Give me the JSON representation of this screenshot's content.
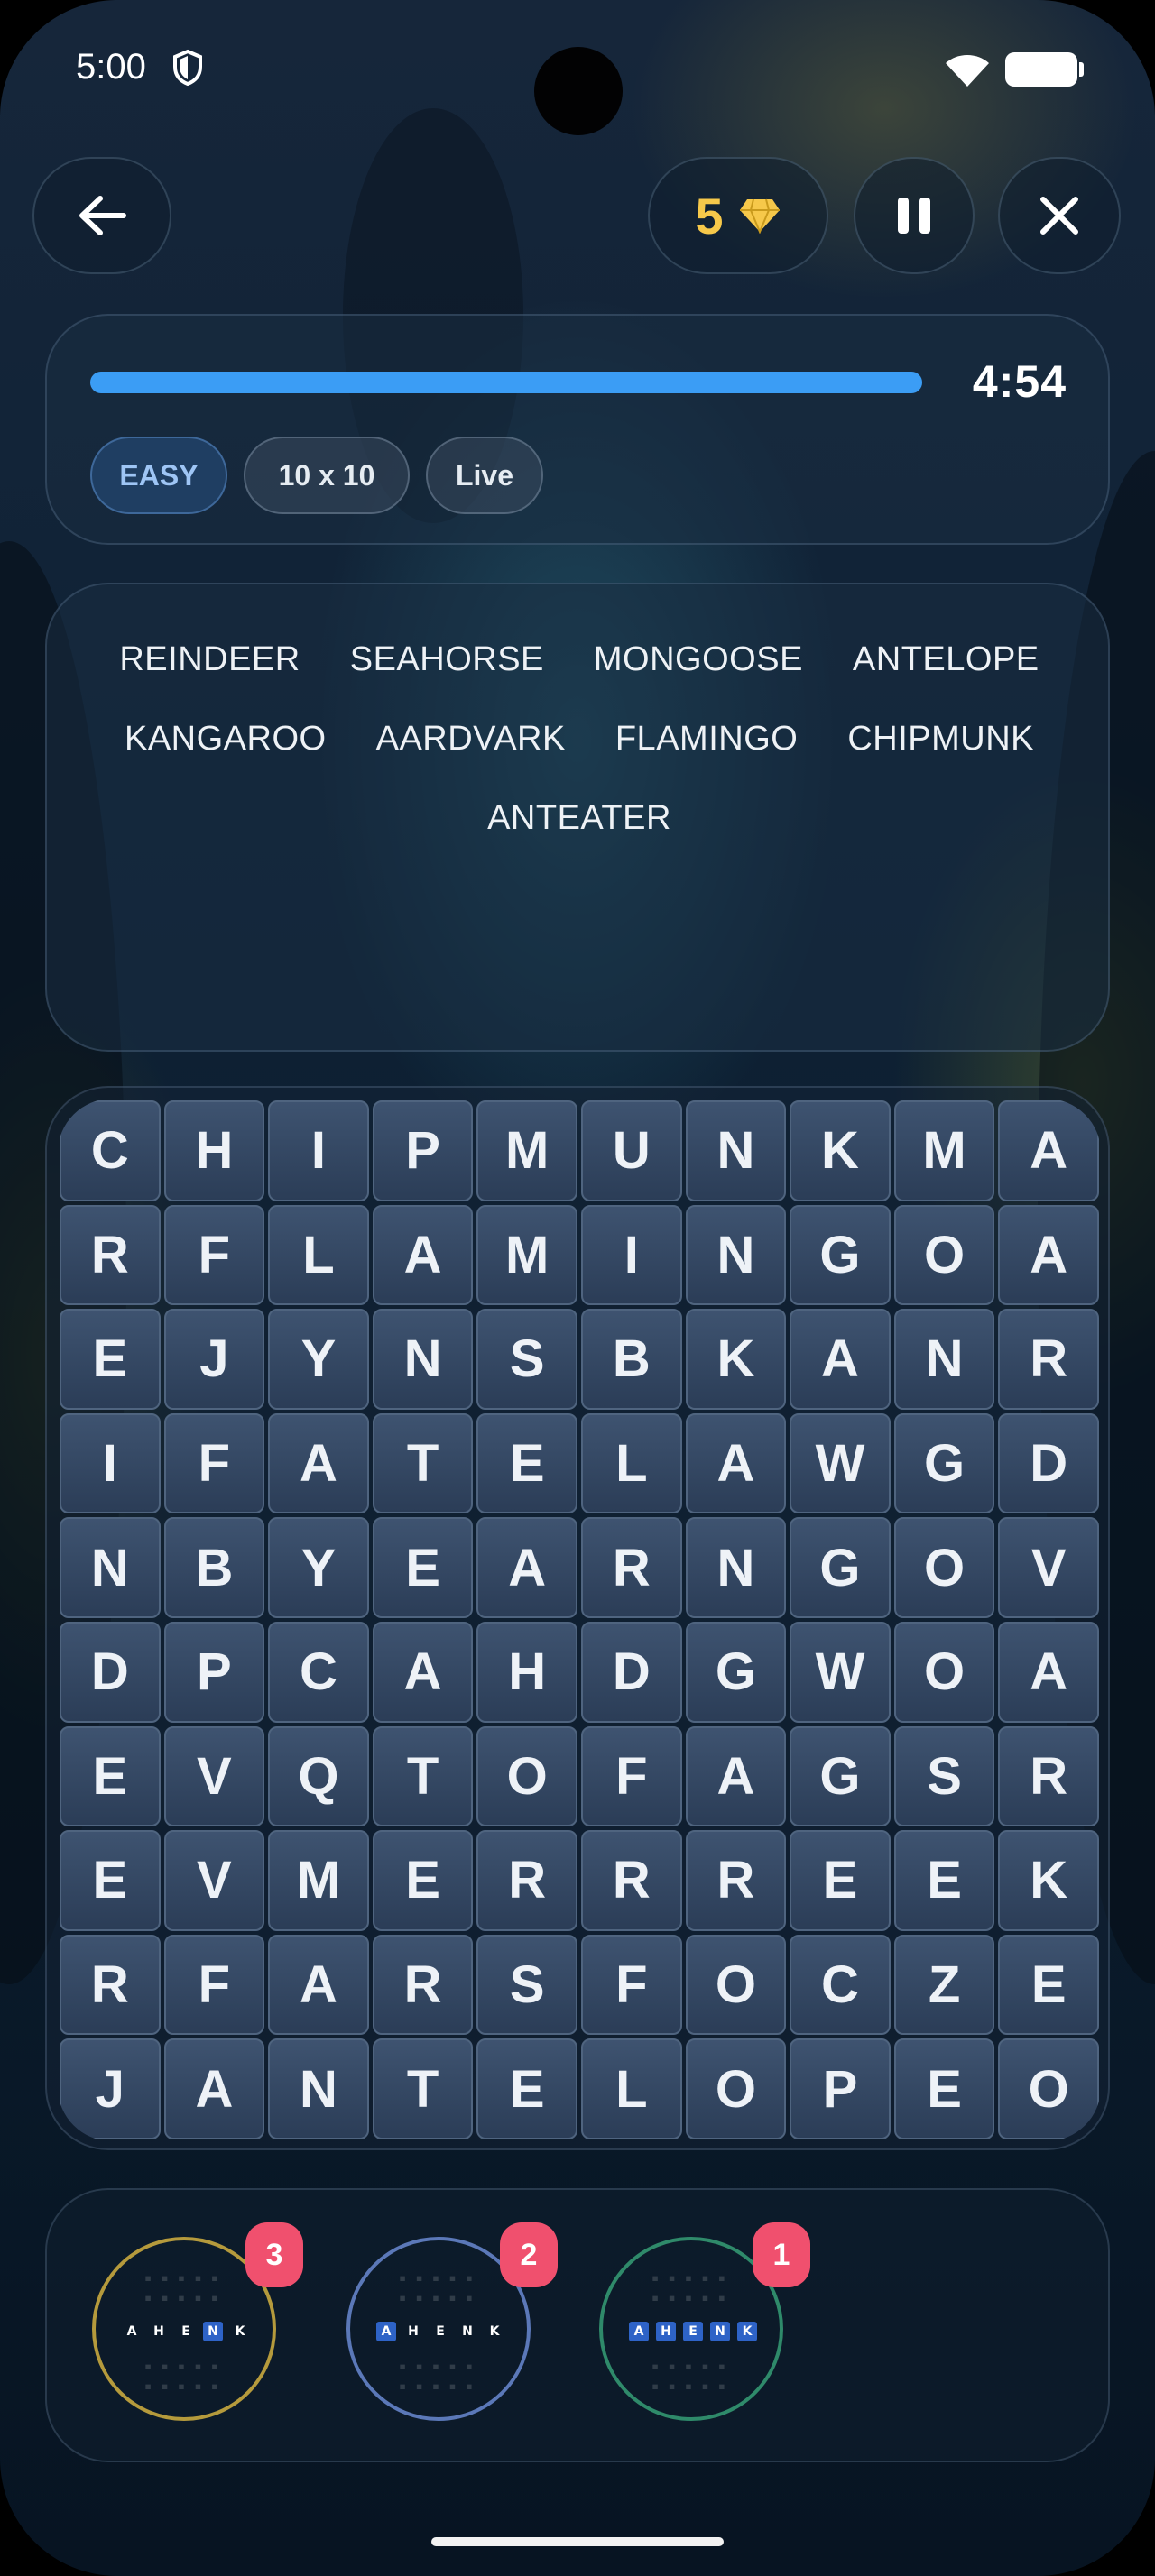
{
  "status_bar": {
    "time": "5:00"
  },
  "toolbar": {
    "gems": "5"
  },
  "game_info": {
    "timer": "4:54",
    "progress": 1.0,
    "difficulty": "EASY",
    "grid_size": "10 x 10",
    "mode": "Live"
  },
  "words": [
    "REINDEER",
    "SEAHORSE",
    "MONGOOSE",
    "ANTELOPE",
    "KANGAROO",
    "AARDVARK",
    "FLAMINGO",
    "CHIPMUNK",
    "ANTEATER"
  ],
  "grid": [
    [
      "C",
      "H",
      "I",
      "P",
      "M",
      "U",
      "N",
      "K",
      "M",
      "A"
    ],
    [
      "R",
      "F",
      "L",
      "A",
      "M",
      "I",
      "N",
      "G",
      "O",
      "A"
    ],
    [
      "E",
      "J",
      "Y",
      "N",
      "S",
      "B",
      "K",
      "A",
      "N",
      "R"
    ],
    [
      "I",
      "F",
      "A",
      "T",
      "E",
      "L",
      "A",
      "W",
      "G",
      "D"
    ],
    [
      "N",
      "B",
      "Y",
      "E",
      "A",
      "R",
      "N",
      "G",
      "O",
      "V"
    ],
    [
      "D",
      "P",
      "C",
      "A",
      "H",
      "D",
      "G",
      "W",
      "O",
      "A"
    ],
    [
      "E",
      "V",
      "Q",
      "T",
      "O",
      "F",
      "A",
      "G",
      "S",
      "R"
    ],
    [
      "E",
      "V",
      "M",
      "E",
      "R",
      "R",
      "R",
      "E",
      "E",
      "K"
    ],
    [
      "R",
      "F",
      "A",
      "R",
      "S",
      "F",
      "O",
      "C",
      "Z",
      "E"
    ],
    [
      "J",
      "A",
      "N",
      "T",
      "E",
      "L",
      "O",
      "P",
      "E",
      "O"
    ]
  ],
  "hints": [
    {
      "count": "3",
      "color": "#b59a3c",
      "letters": [
        "A",
        "H",
        "E",
        "N",
        "K"
      ],
      "highlight": [
        3
      ]
    },
    {
      "count": "2",
      "color": "#5b78b8",
      "letters": [
        "A",
        "H",
        "E",
        "N",
        "K"
      ],
      "highlight": [
        0
      ]
    },
    {
      "count": "1",
      "color": "#2f8a6a",
      "letters": [
        "A",
        "H",
        "E",
        "N",
        "K"
      ],
      "highlight": [
        0,
        1,
        2,
        3,
        4
      ]
    }
  ]
}
